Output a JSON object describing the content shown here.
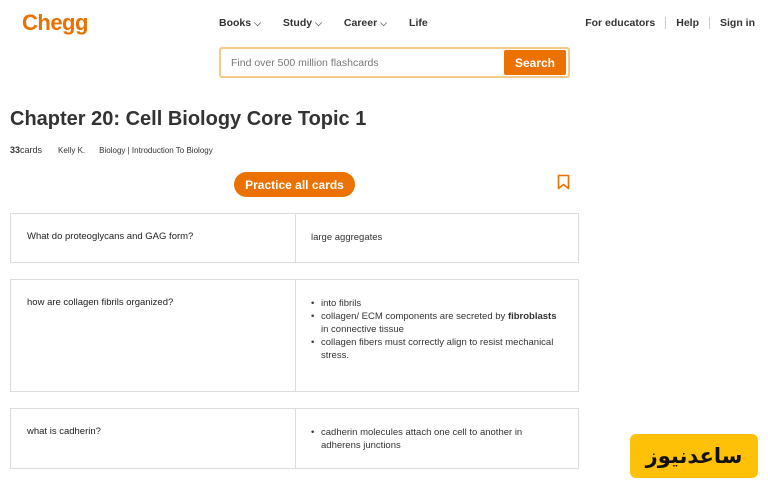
{
  "header": {
    "logo": "Chegg",
    "nav": [
      {
        "label": "Books",
        "has_menu": true
      },
      {
        "label": "Study",
        "has_menu": true
      },
      {
        "label": "Career",
        "has_menu": true
      },
      {
        "label": "Life",
        "has_menu": false
      }
    ],
    "right_links": [
      "For educators",
      "Help",
      "Sign in"
    ]
  },
  "search": {
    "placeholder": "Find over 500 million flashcards",
    "button_label": "Search"
  },
  "deck": {
    "title": "Chapter 20: Cell Biology Core Topic 1",
    "card_count": "33",
    "card_count_label": " cards",
    "author": "Kelly K.",
    "subject": "Biology | Introduction To Biology",
    "practice_label": "Practice all cards"
  },
  "cards": [
    {
      "term": "What do proteoglycans and GAG form?",
      "definition": "large aggregates"
    },
    {
      "term": "how are collagen fibrils organized?",
      "bullets": [
        {
          "pre": "into fibrils",
          "bold": "",
          "post": ""
        },
        {
          "pre": "collagen/ ECM components are secreted by ",
          "bold": "fibroblasts",
          "post": " in connective tissue"
        },
        {
          "pre": "collagen fibers must correctly align to resist mechanical stress.",
          "bold": "",
          "post": ""
        }
      ]
    },
    {
      "term": "what is cadherin?",
      "bullets": [
        {
          "pre": "cadherin molecules attach one cell to another in adherens junctions",
          "bold": "",
          "post": ""
        }
      ]
    }
  ],
  "watermark": "ساعدنیوز",
  "colors": {
    "brand": "#eb7100",
    "border": "#dcdcdc",
    "watermark_bg": "#ffc107"
  },
  "icons": {
    "bookmark": "bookmark-icon",
    "chevron": "chevron-down-icon"
  }
}
